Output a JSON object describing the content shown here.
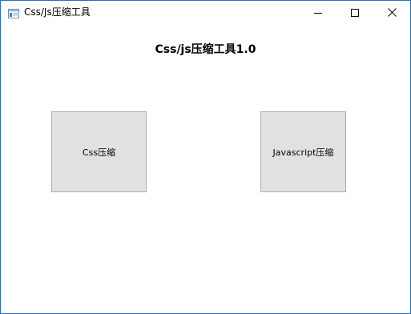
{
  "window": {
    "title": "Css/Js压缩工具",
    "icon": "app-window-icon"
  },
  "controls": {
    "minimize_icon": "minimize-icon",
    "maximize_icon": "maximize-icon",
    "close_icon": "close-icon"
  },
  "main": {
    "heading": "Css/js压缩工具1.0",
    "css_button_label": "Css压缩",
    "js_button_label": "Javascript压缩"
  },
  "colors": {
    "window_border": "#2b6fb3",
    "button_face": "#e1e1e1",
    "button_border": "#adadad"
  }
}
